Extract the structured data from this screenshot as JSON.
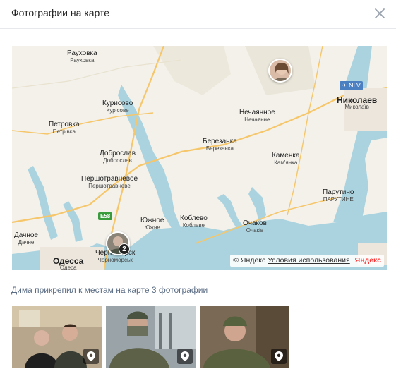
{
  "header": {
    "title": "Фотографии на карте",
    "close_icon": "close-icon"
  },
  "map": {
    "cities": [
      {
        "id": "rauhovka",
        "ru": "Рауховка",
        "uk": "Рауховка"
      },
      {
        "id": "kurisovo",
        "ru": "Курисово",
        "uk": "Курісове"
      },
      {
        "id": "petrovka",
        "ru": "Петровка",
        "uk": "Петрівка"
      },
      {
        "id": "dobroslav",
        "ru": "Доброслав",
        "uk": "Доброслав"
      },
      {
        "id": "pershotravnevoe",
        "ru": "Першотравневое",
        "uk": "Першотравневе"
      },
      {
        "id": "nechayannoe",
        "ru": "Нечаянное",
        "uk": "Нечаянне"
      },
      {
        "id": "berezanka",
        "ru": "Березанка",
        "uk": "Березанка"
      },
      {
        "id": "kamenka",
        "ru": "Каменка",
        "uk": "Кам'янка"
      },
      {
        "id": "nikolaev",
        "ru": "Николаев",
        "uk": "Миколаїв"
      },
      {
        "id": "parutino",
        "ru": "Парутино",
        "uk": "ПАРУТИНЕ"
      },
      {
        "id": "ochakov",
        "ru": "Очаков",
        "uk": "Очаків"
      },
      {
        "id": "koblevo",
        "ru": "Коблево",
        "uk": "Коблеве"
      },
      {
        "id": "yuzhnoe",
        "ru": "Южное",
        "uk": "Южне"
      },
      {
        "id": "chernomorsk",
        "ru": "Черноморск",
        "uk": "Чорноморськ"
      },
      {
        "id": "dachnoe",
        "ru": "Дачное",
        "uk": "Дачне"
      },
      {
        "id": "odessa",
        "ru": "Одесса",
        "uk": "Одеса"
      }
    ],
    "road_badge": "E58",
    "airport_label": "NLV",
    "cluster_count": "2",
    "copyright": "© Яндекс",
    "terms_link": "Условия использования",
    "yandex_logo": "Яндекс"
  },
  "caption": "Дима прикрепил к местам на карте 3 фотографии",
  "photos": [
    {
      "icon": "location-pin-icon"
    },
    {
      "icon": "location-pin-icon"
    },
    {
      "icon": "location-pin-icon"
    }
  ],
  "colors": {
    "water": "#aad3df",
    "land": "#f3f1ea",
    "road": "#f6c66a",
    "link": "#5b6d85"
  }
}
